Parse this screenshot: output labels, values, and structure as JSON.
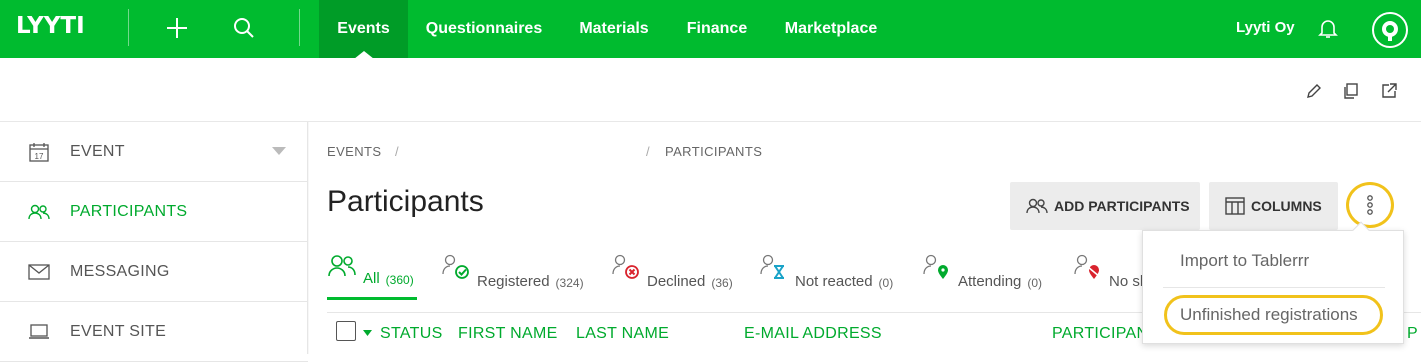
{
  "topbar": {
    "logo": "LYYTI",
    "nav": [
      {
        "label": "Events",
        "active": true
      },
      {
        "label": "Questionnaires",
        "active": false
      },
      {
        "label": "Materials",
        "active": false
      },
      {
        "label": "Finance",
        "active": false
      },
      {
        "label": "Marketplace",
        "active": false
      }
    ],
    "org_name": "Lyyti Oy",
    "icons": [
      "plus-icon",
      "search-icon",
      "bell-icon",
      "avatar"
    ]
  },
  "subbar": {
    "icons": [
      "pencil-icon",
      "copy-icon",
      "external-link-icon"
    ]
  },
  "sidebar": {
    "items": [
      {
        "label": "EVENT",
        "icon": "calendar-icon",
        "icon_text": "17",
        "active": false
      },
      {
        "label": "PARTICIPANTS",
        "icon": "people-icon",
        "active": true
      },
      {
        "label": "MESSAGING",
        "icon": "envelope-icon",
        "active": false
      },
      {
        "label": "EVENT SITE",
        "icon": "laptop-icon",
        "active": false
      }
    ]
  },
  "breadcrumb": {
    "items": [
      "EVENTS",
      "/",
      "/",
      "PARTICIPANTS"
    ]
  },
  "page": {
    "title": "Participants",
    "add_participants_label": "ADD PARTICIPANTS",
    "columns_label": "COLUMNS"
  },
  "tabs": [
    {
      "label": "All",
      "count": "(360)",
      "active": true
    },
    {
      "label": "Registered",
      "count": "(324)",
      "active": false
    },
    {
      "label": "Declined",
      "count": "(36)",
      "active": false
    },
    {
      "label": "Not reacted",
      "count": "(0)",
      "active": false
    },
    {
      "label": "Attending",
      "count": "(0)",
      "active": false
    },
    {
      "label": "No sh",
      "count": "",
      "active": false
    }
  ],
  "table": {
    "columns": [
      "STATUS",
      "FIRST NAME",
      "LAST NAME",
      "E-MAIL ADDRESS",
      "PARTICIPAN",
      "P"
    ]
  },
  "dropdown": {
    "items": [
      "Import to Tablerrr",
      "Unfinished registrations"
    ]
  },
  "colors": {
    "brand_green": "#00bb2f",
    "active_nav": "#009c27",
    "highlight_yellow": "#f1c21b",
    "declined_red": "#d9232d",
    "not_reacted_blue": "#1aa3c8"
  }
}
